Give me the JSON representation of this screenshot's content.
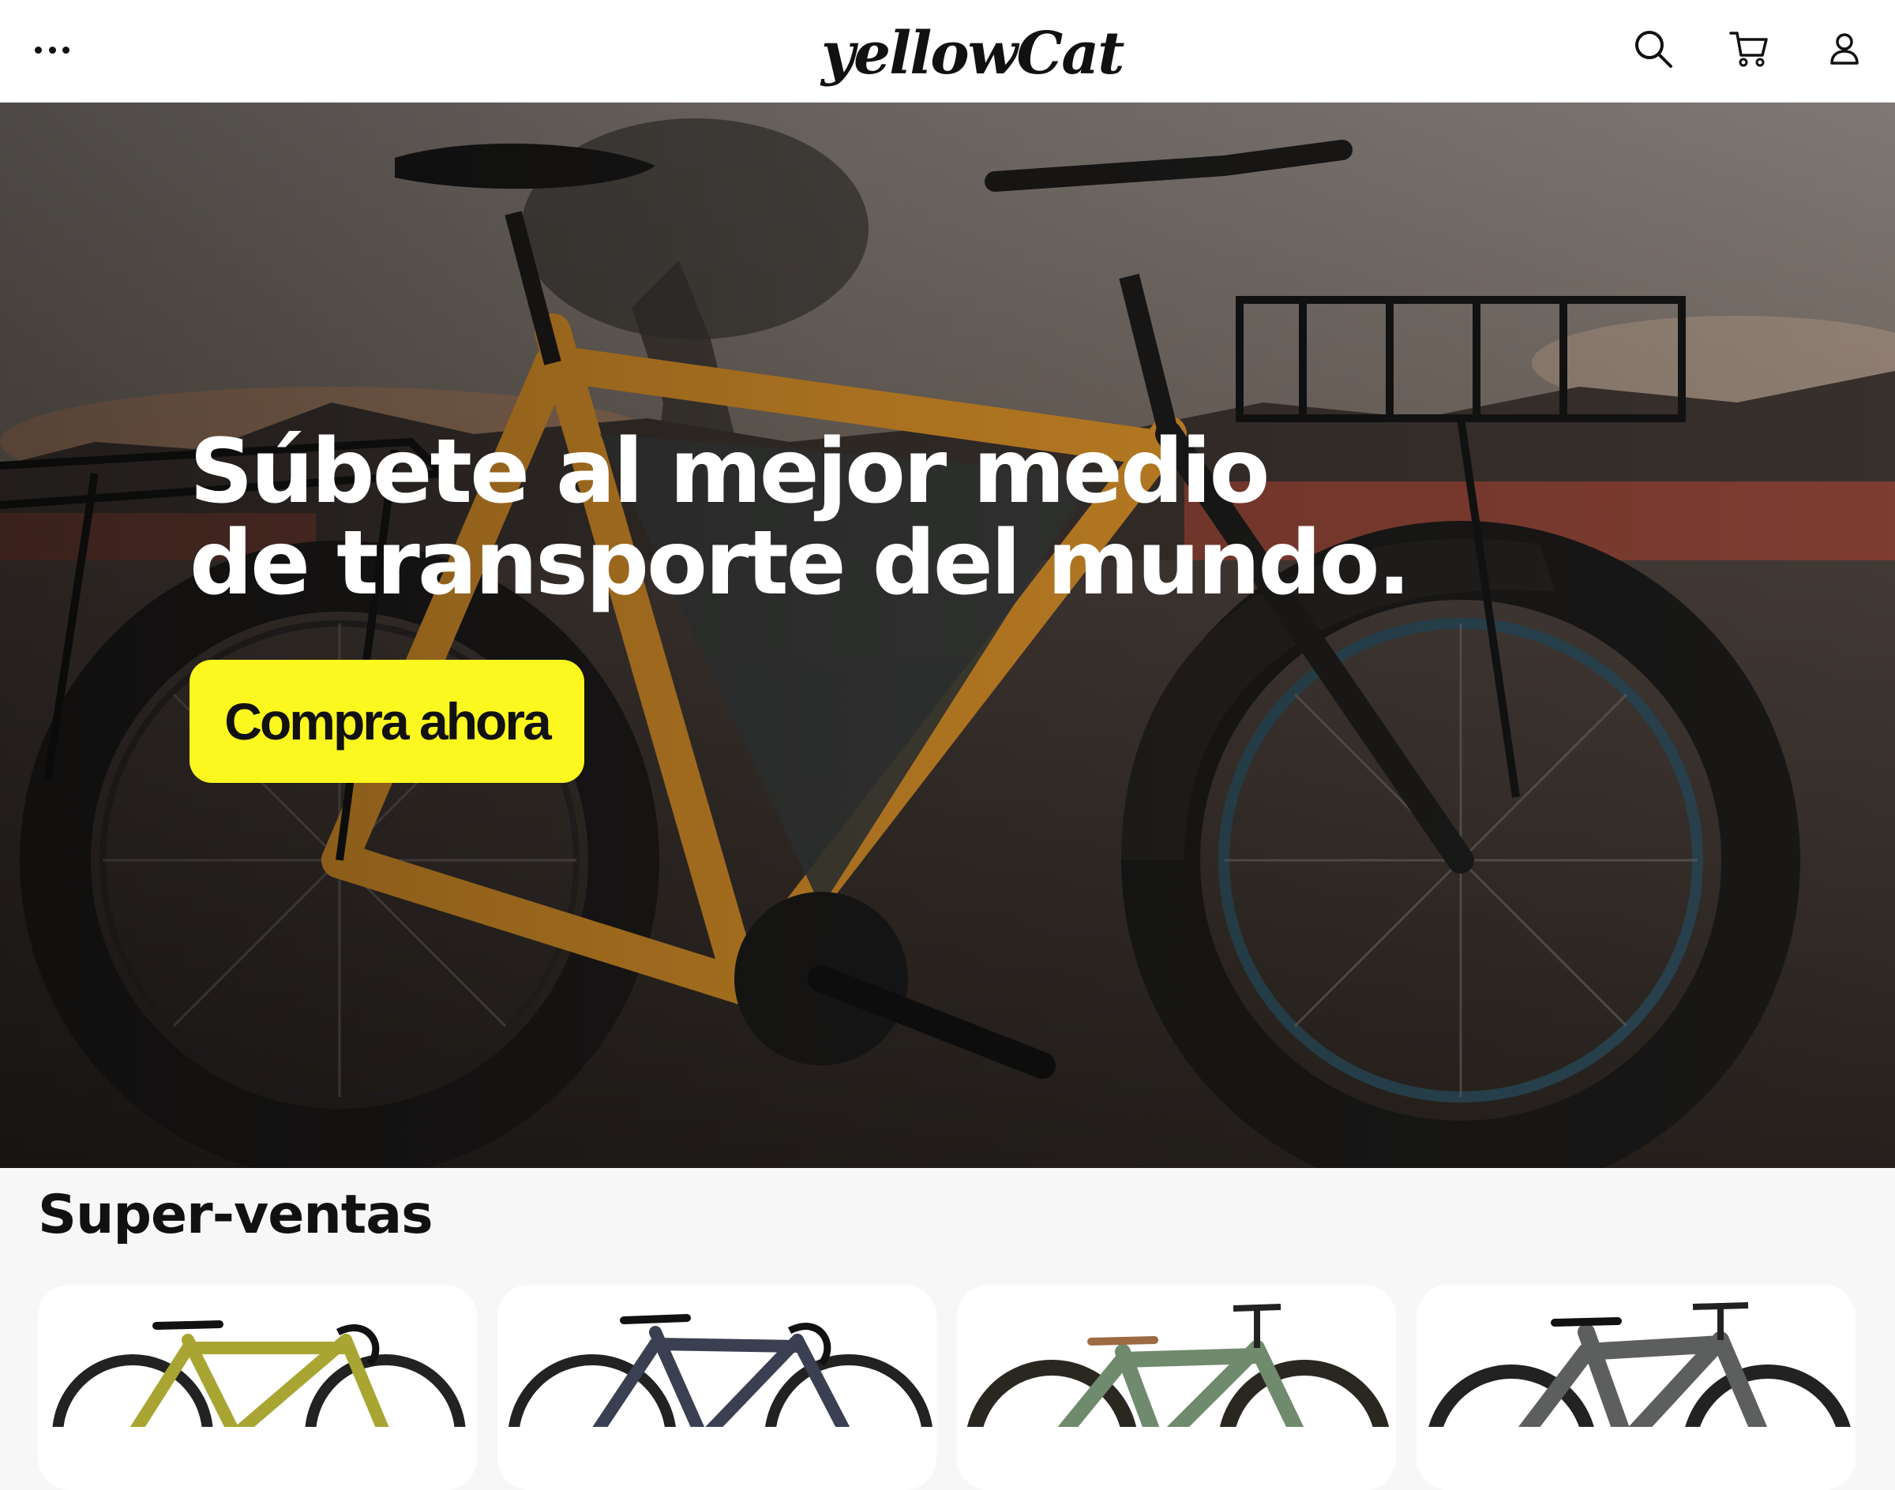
{
  "header": {
    "logo_text": "yellowCat",
    "menu_icon": "more-horizontal-icon",
    "search_icon": "search-icon",
    "cart_icon": "cart-icon",
    "account_icon": "user-icon"
  },
  "hero": {
    "title_line_1": "Súbete al mejor medio",
    "title_line_2": "de transporte del mundo.",
    "cta_label": "Compra ahora",
    "cta_color": "#fcf71f",
    "image_subject": "orange fat-tire bicycle on dirt at sunset"
  },
  "best_sellers": {
    "title": "Super-ventas",
    "products": [
      {
        "frame_color": "#a8a532"
      },
      {
        "frame_color": "#3a3f52"
      },
      {
        "frame_color": "#6f8a6c"
      },
      {
        "frame_color": "#5d5f5e"
      }
    ]
  }
}
